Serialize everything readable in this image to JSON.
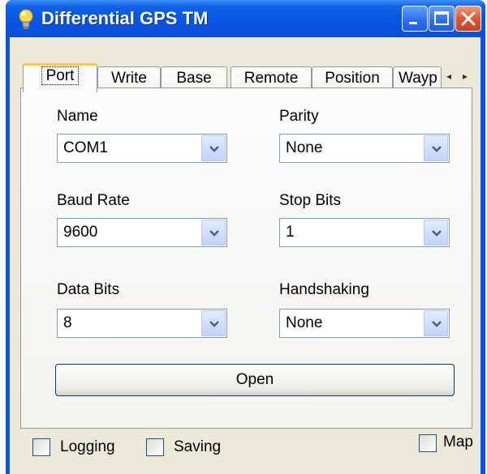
{
  "window": {
    "title": "Differential GPS TM",
    "icon": "lightbulb-icon",
    "controls": [
      "minimize-icon",
      "maximize-icon",
      "close-icon"
    ]
  },
  "tabs": [
    {
      "label": "Port",
      "active": true
    },
    {
      "label": "Write"
    },
    {
      "label": "Base"
    },
    {
      "label": "Remote"
    },
    {
      "label": "Position"
    },
    {
      "label": "Wayp"
    }
  ],
  "tab_scroll": {
    "left": "◂",
    "right": "▸"
  },
  "port": {
    "name": {
      "label": "Name",
      "value": "COM1"
    },
    "parity": {
      "label": "Parity",
      "value": "None"
    },
    "baud_rate": {
      "label": "Baud Rate",
      "value": "9600"
    },
    "stop_bits": {
      "label": "Stop Bits",
      "value": "1"
    },
    "data_bits": {
      "label": "Data Bits",
      "value": "8"
    },
    "handshaking": {
      "label": "Handshaking",
      "value": "None"
    },
    "open_label": "Open"
  },
  "footer": {
    "logging_label": "Logging",
    "saving_label": "Saving",
    "map_label": "Map"
  },
  "colors": {
    "titlebar": "#0a54e4",
    "client": "#ece9d8",
    "active_tab_accent": "#ffc83c",
    "close_button": "#e0502c"
  }
}
